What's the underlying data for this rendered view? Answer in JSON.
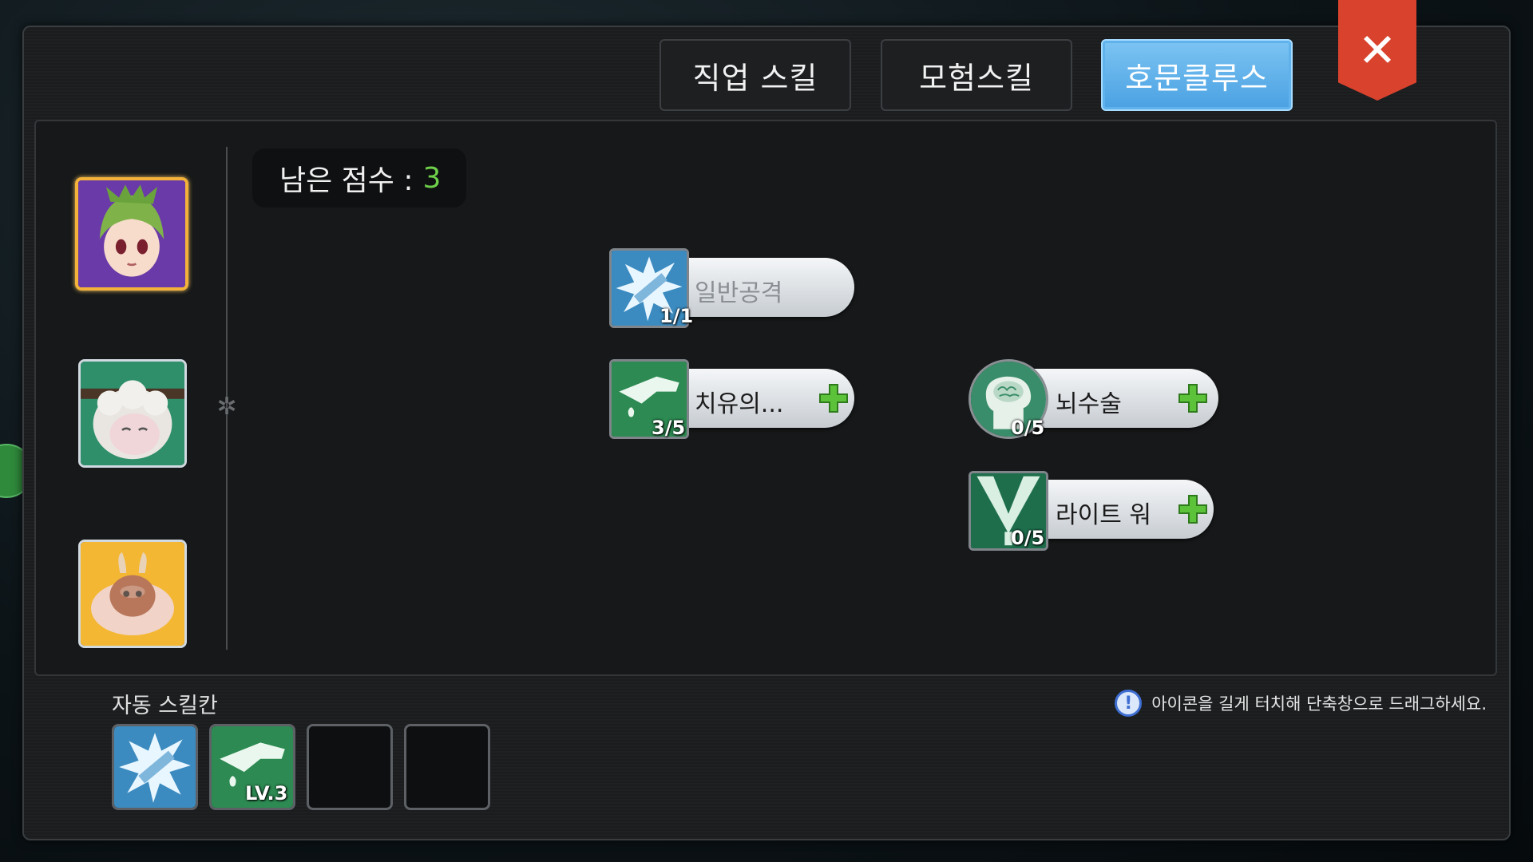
{
  "tabs": [
    {
      "label": "직업 스킬",
      "active": false
    },
    {
      "label": "모험스킬",
      "active": false
    },
    {
      "label": "호문클루스",
      "active": true
    }
  ],
  "close_icon": "close-icon",
  "points": {
    "label": "남은 점수 :",
    "value": "3"
  },
  "homunculi": [
    {
      "name": "green-haired-girl",
      "selected": true
    },
    {
      "name": "sheep",
      "selected": false
    },
    {
      "name": "slime",
      "selected": false
    }
  ],
  "skills": [
    {
      "name": "일반공격",
      "level": "1/1",
      "icon": "sword-slash-icon",
      "dim": true,
      "can_add": false
    },
    {
      "name": "치유의...",
      "level": "3/5",
      "icon": "healing-hand-icon",
      "dim": false,
      "can_add": true
    },
    {
      "name": "뇌수술",
      "level": "0/5",
      "icon": "brain-icon",
      "dim": false,
      "can_add": true
    },
    {
      "name": "라이트 워",
      "level": "0/5",
      "icon": "light-beam-icon",
      "dim": false,
      "can_add": true
    }
  ],
  "auto_skills": {
    "label": "자동 스킬칸",
    "slots": [
      {
        "icon": "sword-slash-icon",
        "badge": ""
      },
      {
        "icon": "healing-hand-icon",
        "badge": "LV.3"
      },
      {
        "icon": "",
        "badge": ""
      },
      {
        "icon": "",
        "badge": ""
      }
    ]
  },
  "hint": {
    "icon": "info-icon",
    "text": "아이콘을 길게 터치해 단축창으로 드래그하세요."
  },
  "colors": {
    "accent_tab": "#5aaeea",
    "points_value": "#6ed04a",
    "close": "#d9432e",
    "selected_border": "#f3b23a"
  }
}
